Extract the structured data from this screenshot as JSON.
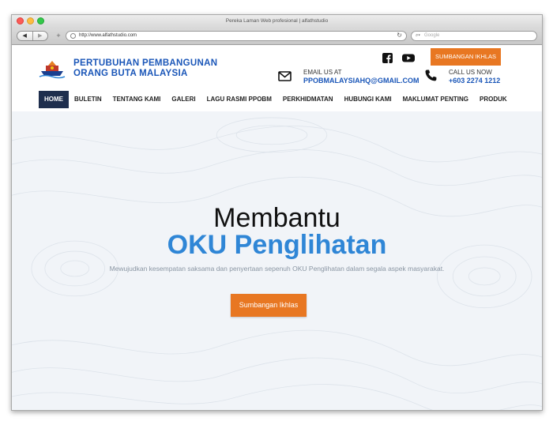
{
  "browser": {
    "window_title": "Pereka Laman Web profesional | alfathstudio",
    "url": "http://www.alfathstudio.com",
    "search_placeholder": "Google",
    "back": "◀",
    "forward": "▶",
    "new_tab": "+",
    "reload": "↻"
  },
  "header": {
    "org_line1": "PERTUBUHAN PEMBANGUNAN",
    "org_line2": "ORANG BUTA MALAYSIA",
    "donate_label": "SUMBANGAN IKHLAS",
    "email_label": "EMAIL US AT",
    "email_value": "PPOBMALAYSIAHQ@GMAIL.COM",
    "call_label": "CALL US NOW",
    "call_value": "+603 2274 1212"
  },
  "nav": {
    "items": [
      {
        "label": "HOME",
        "active": true
      },
      {
        "label": "BULETIN"
      },
      {
        "label": "TENTANG KAMI"
      },
      {
        "label": "GALERI"
      },
      {
        "label": "LAGU RASMI PPOBM"
      },
      {
        "label": "PERKHIDMATAN"
      },
      {
        "label": "HUBUNGI KAMI"
      },
      {
        "label": "MAKLUMAT PENTING"
      },
      {
        "label": "PRODUK"
      }
    ]
  },
  "hero": {
    "line1": "Membantu",
    "line2": "OKU Penglihatan",
    "subtitle": "Mewujudkan kesempatan saksama dan penyertaan sepenuh OKU Penglihatan dalam segala aspek masyarakat.",
    "button_label": "Sumbangan Ikhlas"
  },
  "colors": {
    "brand_blue": "#1a56b8",
    "accent_orange": "#e87722",
    "nav_active": "#1f2f4e",
    "hero_blue": "#2f86d6"
  }
}
